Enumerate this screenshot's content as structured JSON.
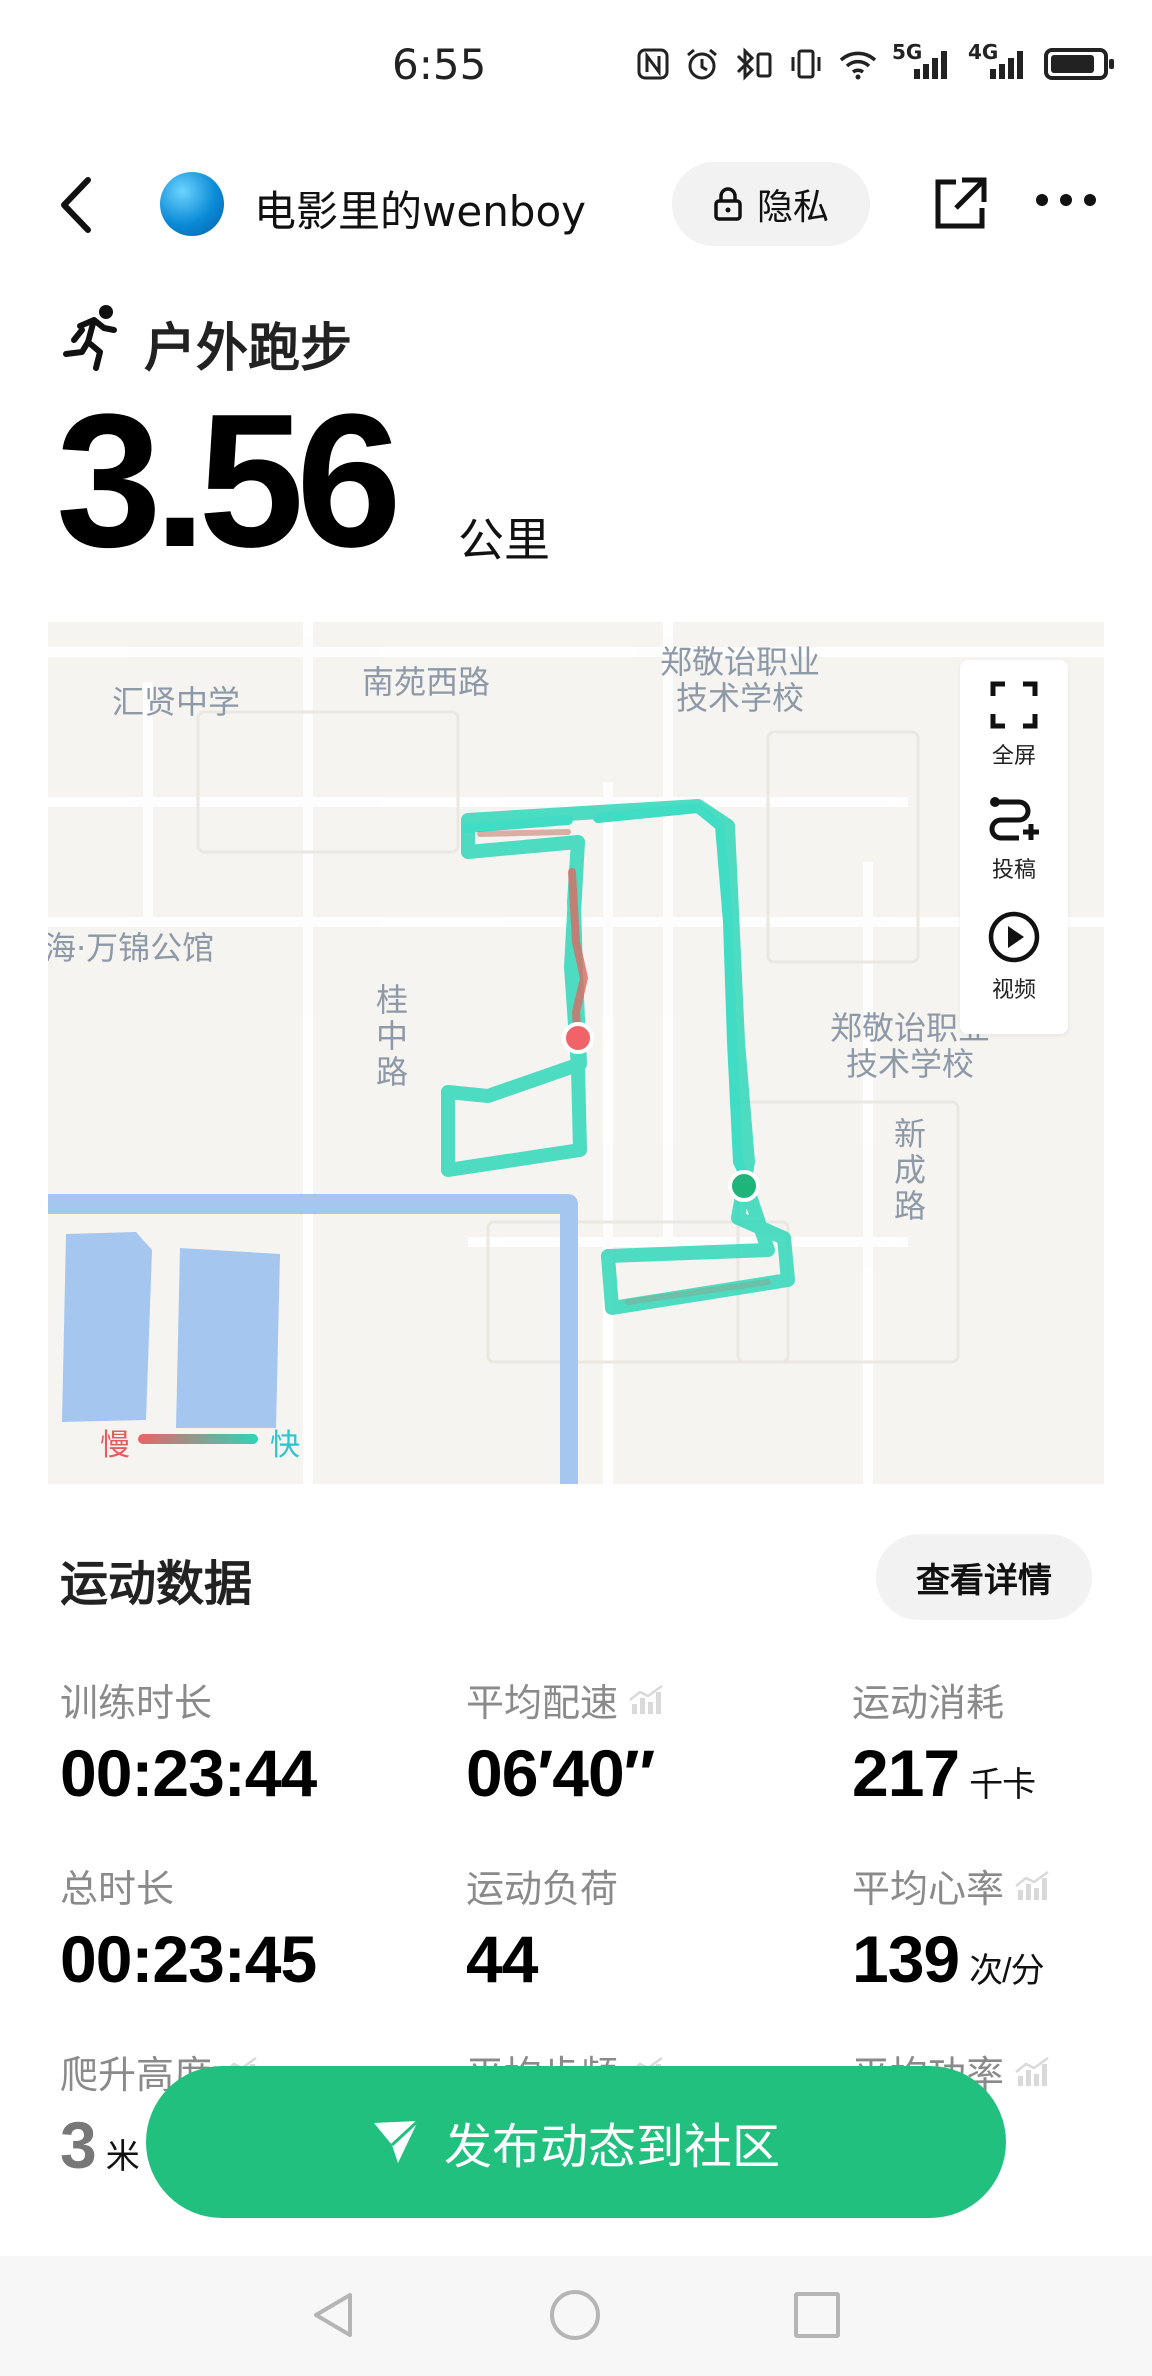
{
  "status_bar": {
    "time": "6:55",
    "net_5g": "5G",
    "net_4g": "4G",
    "battery_level": 0.85,
    "icons": [
      "nfc-icon",
      "alarm-icon",
      "bluetooth-icon",
      "vibrate-icon",
      "wifi-icon",
      "signal-5g-icon",
      "signal-4g-icon",
      "battery-icon"
    ]
  },
  "header": {
    "username": "电影里的wenboy",
    "privacy_label": "隐私",
    "icons": [
      "back-icon",
      "avatar",
      "lock-icon",
      "share-icon",
      "more-icon"
    ]
  },
  "workout": {
    "sport_type": "户外跑步",
    "distance": "3.56",
    "distance_unit": "公里"
  },
  "map": {
    "labels": {
      "school_1": "汇贤中学",
      "road_1": "南苑西路",
      "college_top_line1": "郑敬诒职业",
      "college_top_line2": "技术学校",
      "residence": "海·万锦公馆",
      "road_2": "桂中路",
      "college_right_line1": "郑敬诒职业",
      "college_right_line2": "技术学校",
      "road_3": "新成路"
    },
    "tools": {
      "fullscreen": "全屏",
      "submit": "投稿",
      "video": "视频"
    },
    "legend": {
      "slow": "慢",
      "fast": "快"
    },
    "colors": {
      "route": "#2fd6b9",
      "slow": "#e35d5d",
      "water": "#a4c6ef",
      "start": "#f06368",
      "end": "#1fb57a"
    }
  },
  "stats": {
    "section_title": "运动数据",
    "detail_button": "查看详情",
    "items": [
      {
        "label": "训练时长",
        "value": "00:23:44",
        "unit": ""
      },
      {
        "label": "平均配速",
        "value": "06′40″",
        "unit": ""
      },
      {
        "label": "运动消耗",
        "value": "217",
        "unit": "千卡"
      },
      {
        "label": "总时长",
        "value": "00:23:45",
        "unit": ""
      },
      {
        "label": "运动负荷",
        "value": "44",
        "unit": ""
      },
      {
        "label": "平均心率",
        "value": "139",
        "unit": "次/分"
      },
      {
        "label": "爬升高度",
        "value": "3",
        "unit": "米"
      },
      {
        "label": "平均步频",
        "value": "",
        "unit": ""
      },
      {
        "label": "平均功率",
        "value": "",
        "unit": ""
      }
    ]
  },
  "publish_button": "发布动态到社区",
  "nav_bar": {
    "icons": [
      "nav-back-icon",
      "nav-home-icon",
      "nav-recent-icon"
    ]
  }
}
